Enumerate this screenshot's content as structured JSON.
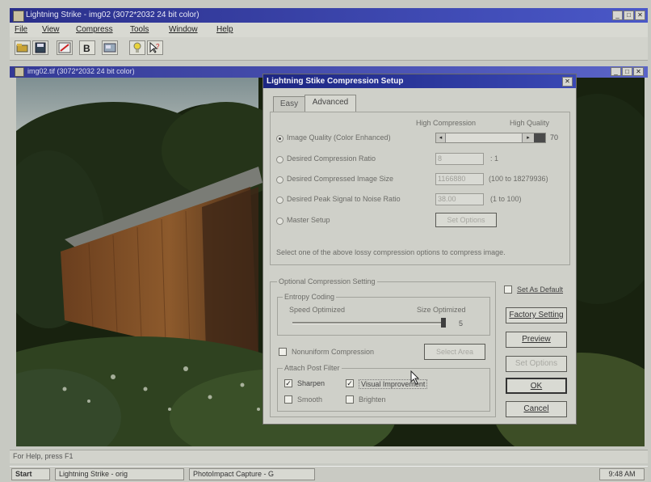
{
  "app": {
    "title": "Lightning Strike - img02 (3072*2032 24 bit color)",
    "menu": [
      "File",
      "View",
      "Compress",
      "Tools",
      "Window",
      "Help"
    ]
  },
  "image_window": {
    "title": "img02.tif (3072*2032 24 bit color)"
  },
  "dialog": {
    "title": "Lightning Stike Compression Setup",
    "tabs": [
      "Easy",
      "Advanced"
    ],
    "active_tab": "Advanced",
    "slider_labels": {
      "low": "High Compression",
      "high": "High Quality"
    },
    "options": [
      {
        "label": "Image Quality (Color Enhanced)",
        "selected": true,
        "value": "70"
      },
      {
        "label": "Desired Compression Ratio",
        "selected": false,
        "value": "8",
        "suffix": ": 1"
      },
      {
        "label": "Desired Compressed Image Size",
        "selected": false,
        "value": "1166880",
        "suffix": "(100 to 18279936)"
      },
      {
        "label": "Desired Peak Signal to Noise Ratio",
        "selected": false,
        "value": "38.00",
        "suffix": "(1 to 100)"
      },
      {
        "label": "Master Setup",
        "selected": false,
        "button": "Set Options"
      }
    ],
    "hint": "Select one of the above lossy compression options to compress image.",
    "optional_group": "Optional Compression Setting",
    "entropy_group": "Entropy Coding",
    "entropy_labels": {
      "low": "Speed Optimized",
      "high": "Size Optimized"
    },
    "entropy_value": "5",
    "nonuniform_label": "Nonuniform Compression",
    "nonuniform_checked": false,
    "select_area_button": "Select Area",
    "attach_group": "Attach Post Filter",
    "filters": [
      {
        "label": "Sharpen",
        "checked": true
      },
      {
        "label": "Visual Improvement",
        "checked": true
      },
      {
        "label": "Smooth",
        "checked": false
      },
      {
        "label": "Brighten",
        "checked": false
      }
    ],
    "set_as_default_label": "Set As Default",
    "set_as_default_checked": false,
    "buttons": {
      "factory": "Factory Setting",
      "preview": "Preview",
      "set_options": "Set Options",
      "ok": "OK",
      "cancel": "Cancel"
    }
  },
  "status": "For Help, press F1",
  "taskbar": {
    "start": "Start",
    "tasks": [
      "Lightning Strike - orig",
      "PhotoImpact Capture - G"
    ],
    "clock": "9:48 AM"
  },
  "colors": {
    "title_active": "#2a2f8a",
    "dialog_face": "#cfd0c9",
    "slider_accent": "#4a4a4a"
  }
}
